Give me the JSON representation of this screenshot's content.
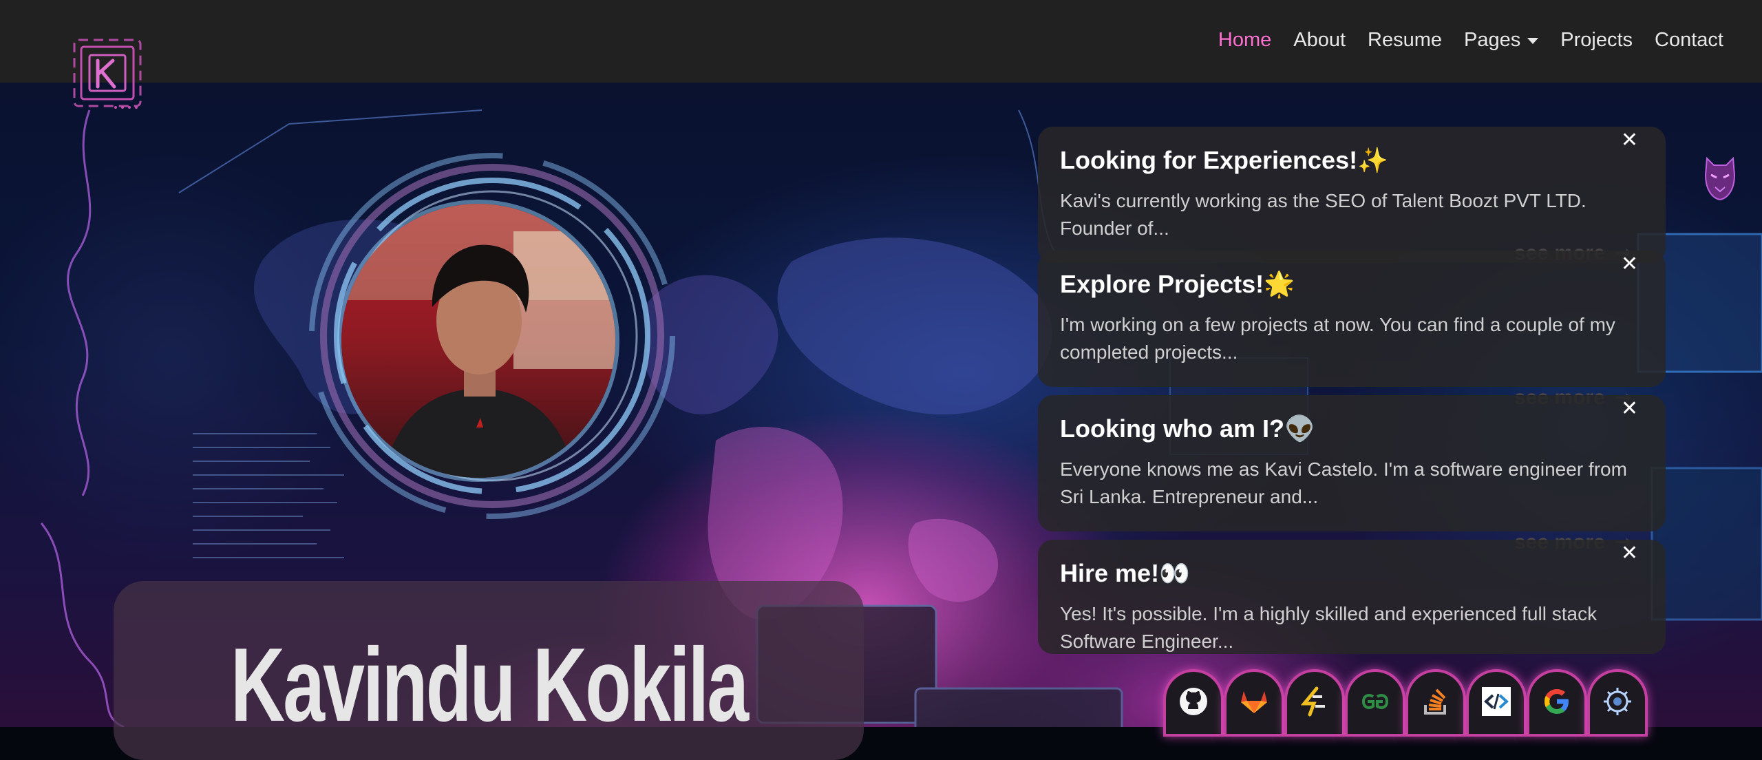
{
  "nav": {
    "links": [
      {
        "label": "Home",
        "active": true
      },
      {
        "label": "About"
      },
      {
        "label": "Resume"
      },
      {
        "label": "Pages",
        "dropdown": true
      },
      {
        "label": "Projects"
      },
      {
        "label": "Contact"
      }
    ],
    "logo_letter": "K"
  },
  "hero": {
    "name": "Kavindu Kokila"
  },
  "toasts": [
    {
      "title": "Looking for Experiences!✨",
      "body": "Kavi's currently working as the SEO of Talent Boozt PVT LTD. Founder of...",
      "close": "✕",
      "see_more": "see more"
    },
    {
      "title": "Explore Projects!🌟",
      "body": "I'm working on a few projects at now. You can find a couple of my completed projects...",
      "close": "✕",
      "see_more": "see more"
    },
    {
      "title": "Looking who am I?👽",
      "body": "Everyone knows me as Kavi Castelo. I'm a software engineer from Sri Lanka. Entrepreneur and...",
      "close": "✕",
      "see_more": "see more"
    },
    {
      "title": "Hire me!👀",
      "body": "Yes! It's possible. I'm a highly skilled and experienced full stack Software Engineer...",
      "close": "✕"
    }
  ],
  "socials": [
    {
      "icon": "github-icon"
    },
    {
      "icon": "gitlab-icon"
    },
    {
      "icon": "hackerrank-icon"
    },
    {
      "icon": "geeksforgeeks-icon"
    },
    {
      "icon": "stackoverflow-icon"
    },
    {
      "icon": "codepen-icon"
    },
    {
      "icon": "google-icon"
    },
    {
      "icon": "globe-icon"
    }
  ],
  "colors": {
    "accent": "#ff6fcf",
    "navbar": "#212121",
    "toast_bg": "#282628",
    "glow": "#c43fa0"
  }
}
